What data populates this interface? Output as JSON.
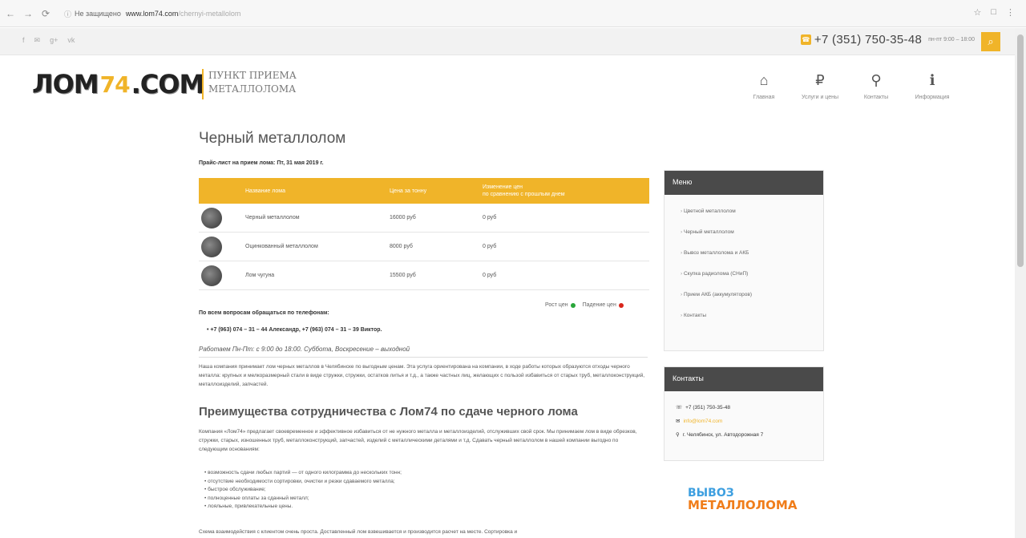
{
  "browser": {
    "nav": [
      "←",
      "→",
      "⟳"
    ],
    "lock": "ⓘ",
    "address_prefix": "Не защищено",
    "url_host": "www.lom74.com",
    "url_path": "/chernyi-metallolom",
    "right_icons": [
      "☆",
      "□",
      "⋮"
    ]
  },
  "topbar": {
    "social": [
      "f",
      "✉",
      "g+",
      "vk"
    ],
    "phone": "+7 (351) 750-35-48",
    "hours": "пн-пт 9:00 – 18:00",
    "search_icon": "search-icon"
  },
  "header": {
    "logo_a": "ЛОМ",
    "logo_b": "74",
    "logo_c": ".COM",
    "tagline_1": "ПУНКТ ПРИЕМА",
    "tagline_2": "МЕТАЛЛОЛОМА",
    "nav": [
      {
        "icon": "home-icon",
        "glyph": "⌂",
        "label": "Главная"
      },
      {
        "icon": "ruble-icon",
        "glyph": "₽",
        "label": "Услуги и цены"
      },
      {
        "icon": "map-pin-icon",
        "glyph": "⚲",
        "label": "Контакты"
      },
      {
        "icon": "info-icon",
        "glyph": "ℹ",
        "label": "Информация"
      }
    ]
  },
  "main": {
    "title": "Черный металлолом",
    "price_date": "Прайс-лист на прием лома: Пт, 31 мая 2019 г.",
    "table": {
      "headers": [
        "Название лома",
        "Цена за тонну",
        "Изменение цен",
        "по сравнению с прошлым днем"
      ],
      "rows": [
        {
          "name": "Черный металлолом",
          "price": "16000 руб",
          "change": "0 руб"
        },
        {
          "name": "Оцинкованный металлолом",
          "price": "8000 руб",
          "change": "0 руб"
        },
        {
          "name": "Лом чугуна",
          "price": "15500 руб",
          "change": "0 руб"
        }
      ]
    },
    "legend_up": "Рост цен",
    "legend_down": "Падение цен",
    "up_color": "#2aa63a",
    "down_color": "#d9261c",
    "phones_heading": "По всем вопросам обращаться по телефонам:",
    "phones_line": "+7 (963) 074 – 31 – 44 Александр, +7 (963) 074 – 31 – 39 Виктор.",
    "hours_line": "Работаем Пн-Пт: с 9:00 до 18:00. Суббота, Воскресение – выходной",
    "intro": "Наша компания принимает лом черных металлов в Челябинске по выгодным ценам. Эта услуга ориентирована на компании, в ходе работы которых образуются отходы черного металла: крупных и мелкоразмерный стали в виде стружки, стружки, остатков литья и т.д., а также частных лиц, желающих с пользой избавиться от старых труб, металлоконструкций, металлоизделий, запчастей.",
    "section_title": "Преимущества сотрудничества с Лом74 по сдаче черного лома",
    "section_text": "Компания «Лом74» предлагает своевременное и эффективное избавиться от не нужного металла и металлоизделий, отслуживших свой срок. Мы принимаем лом в виде обрезков, стружки, старых, изношенных труб, металлоконструкций, запчастей, изделий с металлическими деталями и т.д. Сдавать черный металлолом в нашей компании выгодно по следующим основаниям:",
    "bullets": [
      "возможность сдачи любых партий — от одного килограмма до нескольких тонн;",
      "отсутствие необходимости сортировки, очистки и резки сдаваемого металла;",
      "быстрое обслуживание;",
      "полноценные оплаты за сданный металл;",
      "лояльные, привлекательные цены."
    ],
    "bottom_text": "Схема взаимодействия с клиентом очень проста. Доставленный лом взвешивается и производится расчет на месте. Сортировка и"
  },
  "sidebar": {
    "menu_title": "Меню",
    "menu": [
      "Цветной металлолом",
      "Черный металлолом",
      "Вывоз металлолома и АКБ",
      "Скупка радиолома (СНиП)",
      "Прием АКБ (аккумуляторов)",
      "Контакты"
    ],
    "contacts_title": "Контакты",
    "contact_phone": "+7 (351) 750-35-48",
    "contact_email": "info@lom74.com",
    "contact_address": "г. Челябинск, ул. Автодорожная 7",
    "ad_line1": "ВЫВОЗ",
    "ad_line2": "МЕТАЛЛОЛОМА"
  }
}
